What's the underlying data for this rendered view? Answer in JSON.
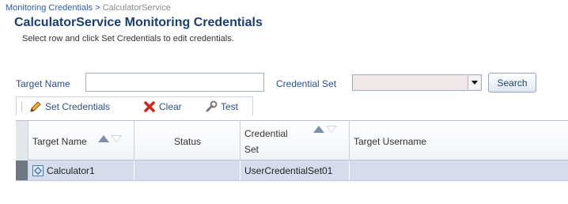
{
  "breadcrumb": {
    "parent": "Monitoring Credentials",
    "separator": ">",
    "current": "CalculatorService"
  },
  "page_title": "CalculatorService Monitoring Credentials",
  "instructions": "Select row and click Set Credentials to edit credentials.",
  "search": {
    "target_name_label": "Target Name",
    "target_name_value": "",
    "credential_set_label": "Credential Set",
    "credential_set_value": "",
    "search_button": "Search"
  },
  "toolbar": {
    "set_credentials": "Set Credentials",
    "clear": "Clear",
    "test": "Test"
  },
  "table": {
    "columns": {
      "target_name": "Target Name",
      "status": "Status",
      "credential_set_line1": "Credential",
      "credential_set_line2": "Set",
      "target_username": "Target Username"
    },
    "rows": [
      {
        "target_name": "Calculator1",
        "status": "",
        "credential_set": "UserCredentialSet01",
        "target_username": ""
      }
    ]
  },
  "colors": {
    "link": "#2a5db0",
    "title": "#1a3d73",
    "label": "#2b4f8a",
    "selected_row": "#d6dcec"
  }
}
